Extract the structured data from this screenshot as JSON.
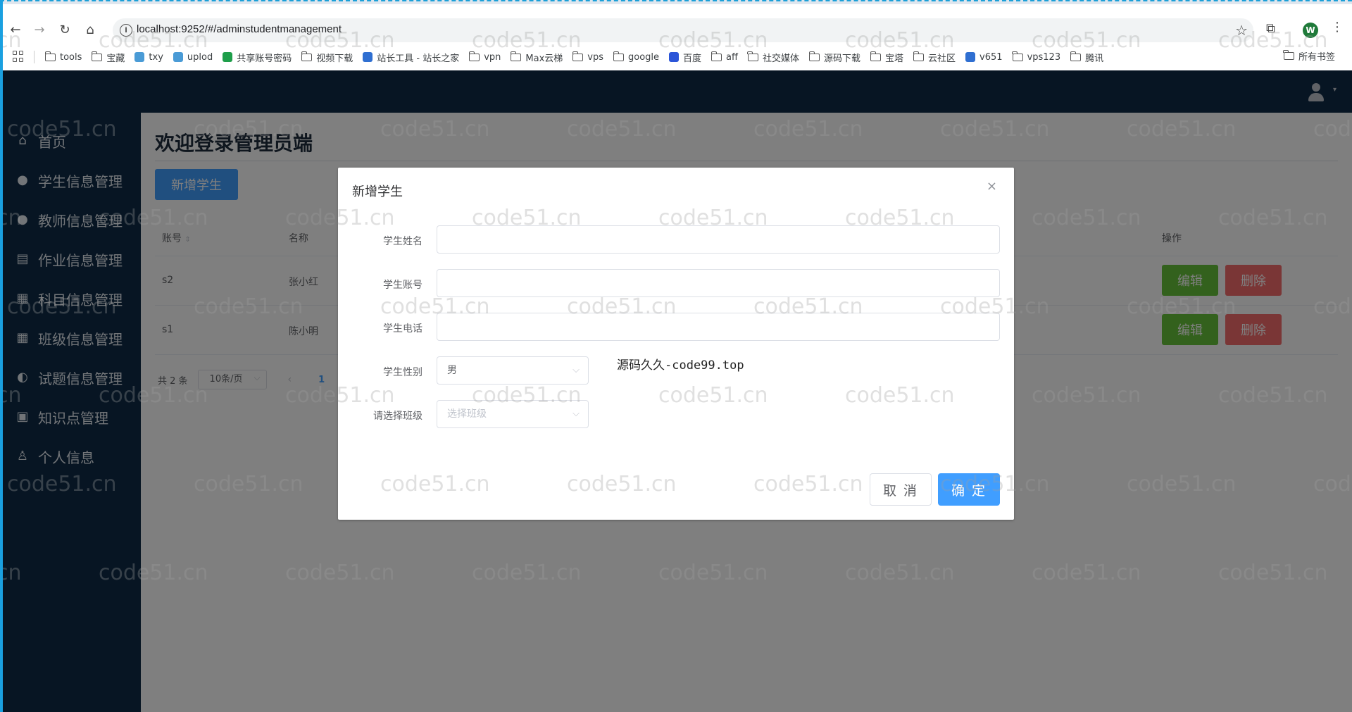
{
  "browser": {
    "url": "localhost:9252/#/adminstudentmanagement",
    "profile_initial": "W",
    "bookmarks": [
      {
        "label": "tools",
        "icon": "folder-icon"
      },
      {
        "label": "宝藏",
        "icon": "folder-icon"
      },
      {
        "label": "txy",
        "icon": "cloud-icon"
      },
      {
        "label": "uplod",
        "icon": "cloud-icon"
      },
      {
        "label": "共享账号密码",
        "icon": "sheet-icon"
      },
      {
        "label": "视频下载",
        "icon": "folder-icon"
      },
      {
        "label": "站长工具 - 站长之家",
        "icon": "site-icon"
      },
      {
        "label": "vpn",
        "icon": "folder-icon"
      },
      {
        "label": "Max云梯",
        "icon": "folder-icon"
      },
      {
        "label": "vps",
        "icon": "folder-icon"
      },
      {
        "label": "google",
        "icon": "folder-icon"
      },
      {
        "label": "百度",
        "icon": "baidu-icon"
      },
      {
        "label": "aff",
        "icon": "folder-icon"
      },
      {
        "label": "社交媒体",
        "icon": "folder-icon"
      },
      {
        "label": "源码下载",
        "icon": "folder-icon"
      },
      {
        "label": "宝塔",
        "icon": "folder-icon"
      },
      {
        "label": "云社区",
        "icon": "folder-icon"
      },
      {
        "label": "v651",
        "icon": "site-icon"
      },
      {
        "label": "vps123",
        "icon": "folder-icon"
      },
      {
        "label": "腾讯",
        "icon": "folder-icon"
      }
    ],
    "all_bookmarks": "所有书签"
  },
  "sidebar": {
    "items": [
      {
        "label": "首页",
        "icon": "home-icon"
      },
      {
        "label": "学生信息管理",
        "icon": "user-icon"
      },
      {
        "label": "教师信息管理",
        "icon": "user-icon"
      },
      {
        "label": "作业信息管理",
        "icon": "clipboard-icon"
      },
      {
        "label": "科目信息管理",
        "icon": "grid-icon"
      },
      {
        "label": "班级信息管理",
        "icon": "grid-icon"
      },
      {
        "label": "试题信息管理",
        "icon": "bulb-icon"
      },
      {
        "label": "知识点管理",
        "icon": "note-icon"
      },
      {
        "label": "个人信息",
        "icon": "person-outline-icon"
      }
    ]
  },
  "main": {
    "title": "欢迎登录管理员端",
    "add_button": "新增学生",
    "columns": {
      "account": "账号",
      "name": "名称",
      "actions": "操作"
    },
    "rows": [
      {
        "account": "s2",
        "name": "张小红",
        "edit": "编辑",
        "delete": "删除"
      },
      {
        "account": "s1",
        "name": "陈小明",
        "edit": "编辑",
        "delete": "删除"
      }
    ],
    "pagination": {
      "total": "共 2 条",
      "page_size": "10条/页",
      "prev": "‹",
      "current": "1"
    }
  },
  "dialog": {
    "title": "新增学生",
    "close": "×",
    "fields": {
      "name_label": "学生姓名",
      "account_label": "学生账号",
      "phone_label": "学生电话",
      "gender_label": "学生性别",
      "gender_value": "男",
      "class_label": "请选择班级",
      "class_placeholder": "选择班级"
    },
    "note": "源码久久-code99.top",
    "cancel": "取 消",
    "confirm": "确 定"
  },
  "watermark": "code51.cn"
}
